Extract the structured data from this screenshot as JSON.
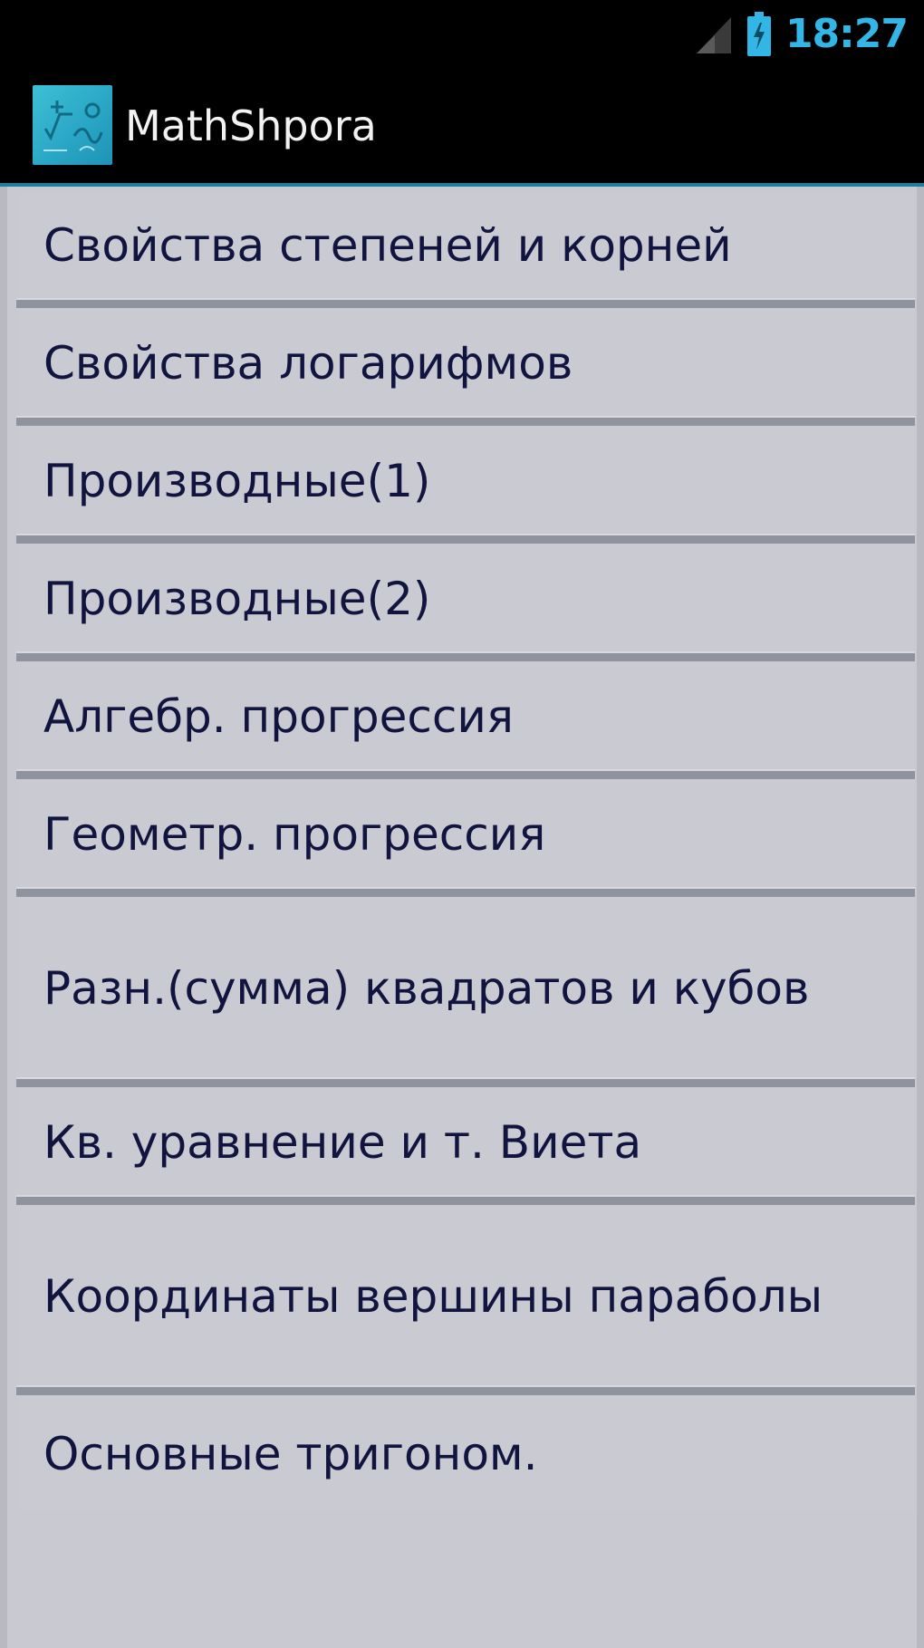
{
  "status_bar": {
    "time": "18:27",
    "clock_color": "#33b5e5",
    "icons": [
      "signal-icon",
      "battery-icon"
    ]
  },
  "action_bar": {
    "title": "MathShpora",
    "app_icon": "app-icon",
    "background": "#000000"
  },
  "menu": {
    "background": "#cacad2",
    "text_color": "#121440",
    "items": [
      {
        "label": "Свойства степеней и корней"
      },
      {
        "label": "Свойства логарифмов"
      },
      {
        "label": "Производные(1)"
      },
      {
        "label": "Производные(2)"
      },
      {
        "label": "Алгебр. прогрессия"
      },
      {
        "label": "Геометр. прогрессия"
      },
      {
        "label": "Разн.(сумма) квадратов и кубов"
      },
      {
        "label": "Кв. уравнение и т. Виета"
      },
      {
        "label": "Координаты вершины параболы"
      },
      {
        "label": "Основные тригоном."
      }
    ]
  }
}
